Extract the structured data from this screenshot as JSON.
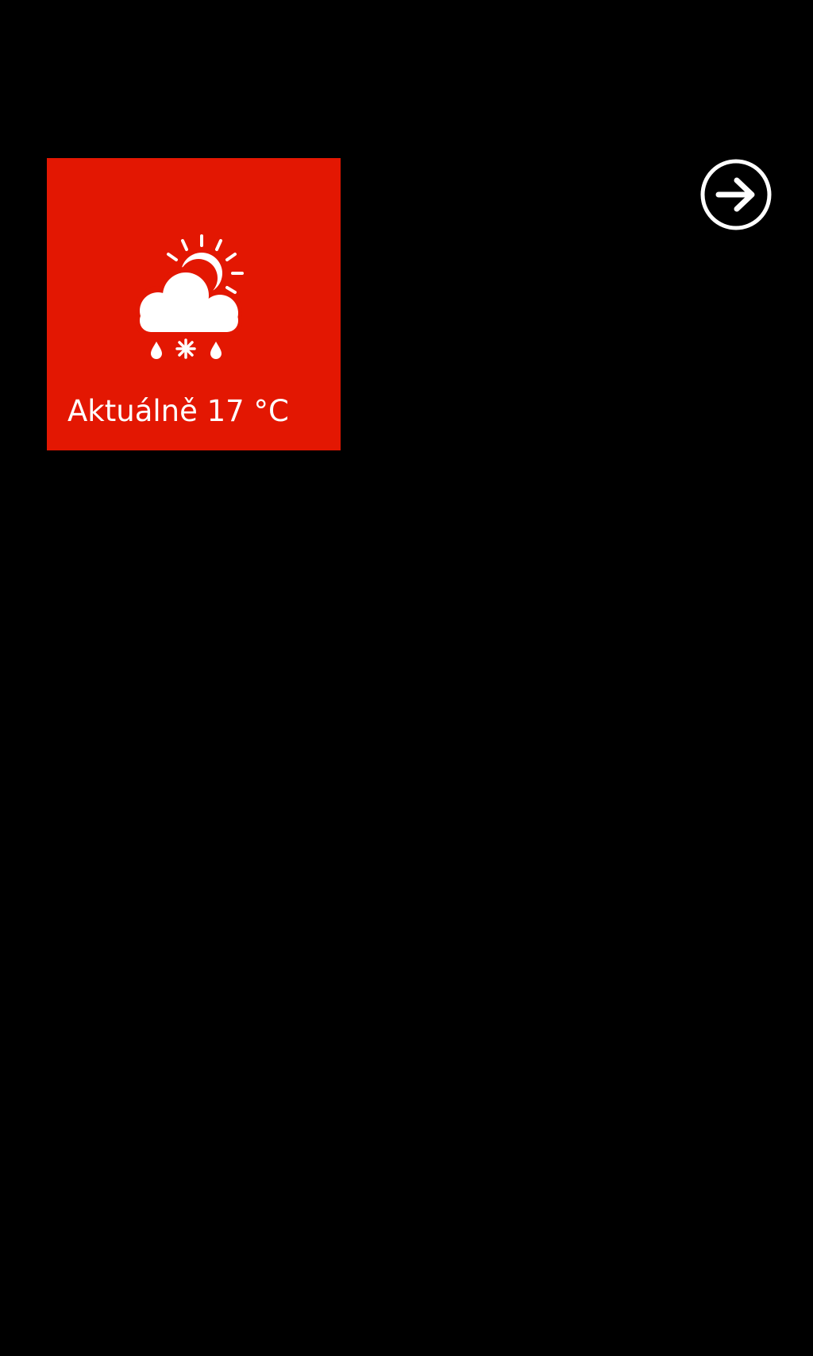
{
  "colors": {
    "background": "#000000",
    "tile_accent": "#e31702",
    "foreground": "#ffffff"
  },
  "weather_tile": {
    "label": "Aktuálně 17 °C",
    "icon": "partly-cloudy-sleet-icon"
  },
  "next_button": {
    "icon": "arrow-right-circle-icon"
  }
}
